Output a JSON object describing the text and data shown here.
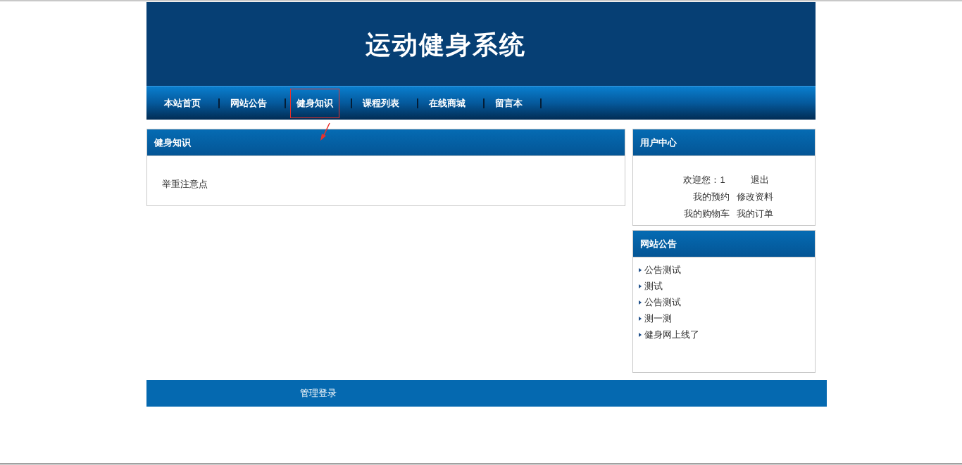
{
  "header": {
    "title": "运动健身系统"
  },
  "nav": [
    {
      "label": "本站首页",
      "selected": false
    },
    {
      "label": "网站公告",
      "selected": false
    },
    {
      "label": "健身知识",
      "selected": true
    },
    {
      "label": "课程列表",
      "selected": false
    },
    {
      "label": "在线商城",
      "selected": false
    },
    {
      "label": "留言本",
      "selected": false
    }
  ],
  "main_panel": {
    "title": "健身知识",
    "items": [
      "举重注意点"
    ]
  },
  "user_center": {
    "title": "用户中心",
    "welcome": "欢迎您：1",
    "logout": "退出",
    "links": [
      [
        "我的预约",
        "修改资料"
      ],
      [
        "我的购物车",
        "我的订单"
      ]
    ]
  },
  "notices": {
    "title": "网站公告",
    "items": [
      "公告测试",
      "测试",
      "公告测试",
      "测一测",
      "健身网上线了"
    ]
  },
  "footer": {
    "link": "管理登录"
  }
}
